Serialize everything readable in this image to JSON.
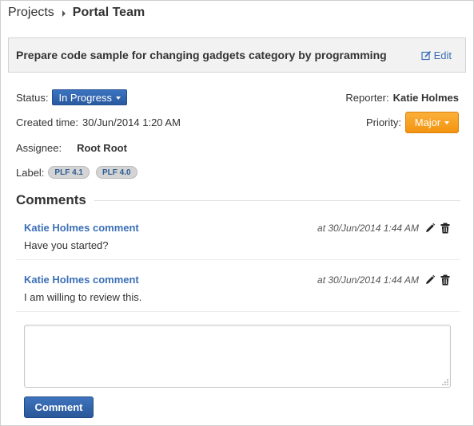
{
  "breadcrumb": {
    "root": "Projects",
    "current": "Portal Team"
  },
  "task": {
    "title": "Prepare code sample for changing gadgets category by programming",
    "edit_label": "Edit"
  },
  "fields": {
    "status_label": "Status:",
    "status_value": "In Progress",
    "reporter_label": "Reporter:",
    "reporter_value": "Katie Holmes",
    "created_label": "Created time:",
    "created_value": "30/Jun/2014 1:20 AM",
    "priority_label": "Priority:",
    "priority_value": "Major",
    "assignee_label": "Assignee:",
    "assignee_value": "Root Root",
    "label_label": "Label:",
    "labels": [
      "PLF 4.1",
      "PLF 4.0"
    ]
  },
  "comments": {
    "heading": "Comments",
    "items": [
      {
        "author": "Katie Holmes comment",
        "time": "at 30/Jun/2014 1:44 AM",
        "text": "Have you started?"
      },
      {
        "author": "Katie Holmes comment",
        "time": "at 30/Jun/2014 1:44 AM",
        "text": "I am willing to review this."
      }
    ],
    "input_value": "",
    "submit_label": "Comment"
  },
  "colors": {
    "status_button": "#2f63ad",
    "priority_button": "#f6a121",
    "link": "#3b6fb6",
    "submit_button": "#2f5fa5"
  },
  "icons": [
    "chevron-right-icon",
    "edit-icon",
    "caret-down-icon",
    "pencil-icon",
    "trash-icon",
    "resize-grip-icon"
  ]
}
